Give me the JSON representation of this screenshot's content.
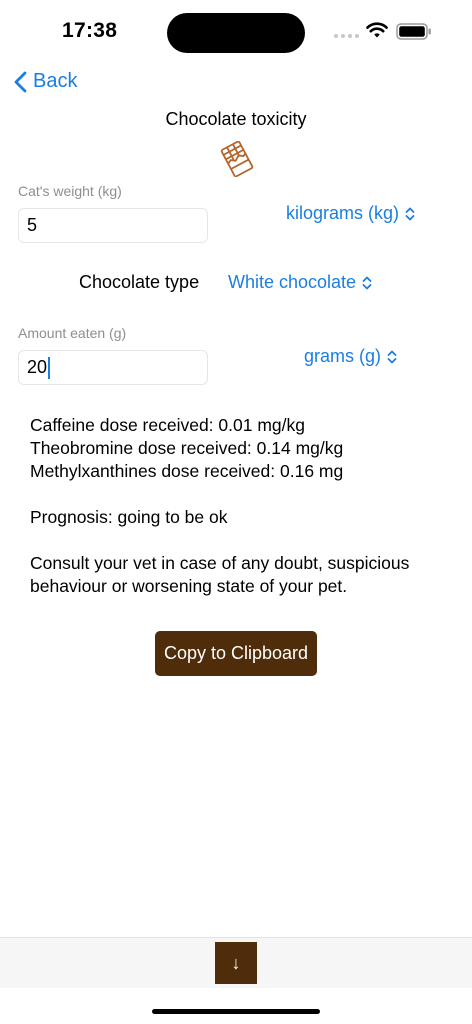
{
  "status_bar": {
    "time": "17:38"
  },
  "nav": {
    "back_label": "Back",
    "title": "Chocolate toxicity"
  },
  "form": {
    "weight_label": "Cat's weight (kg)",
    "weight_value": "5",
    "weight_unit": "kilograms (kg)",
    "chocolate_type_label": "Chocolate type",
    "chocolate_type_value": "White chocolate",
    "amount_label": "Amount eaten (g)",
    "amount_value": "20",
    "amount_unit": "grams (g)"
  },
  "results": {
    "caffeine": "Caffeine dose received: 0.01 mg/kg",
    "theobromine": "Theobromine dose received: 0.14 mg/kg",
    "methylxanthines": "Methylxanthines dose received: 0.16 mg",
    "prognosis": "Prognosis: going to be ok",
    "advice": "Consult your vet in case of any doubt, suspicious behaviour or worsening state of your pet."
  },
  "actions": {
    "copy_label": "Copy to Clipboard",
    "scroll_down_symbol": "↓"
  },
  "icons": {
    "back": "chevron-left-icon",
    "title_icon": "chocolate-bar-icon",
    "picker": "chevron-up-down-icon",
    "wifi": "wifi-icon",
    "battery": "battery-icon"
  },
  "colors": {
    "accent": "#1a7fe0",
    "brand_brown": "#4f2d0a",
    "icon_brown": "#b5652a"
  }
}
